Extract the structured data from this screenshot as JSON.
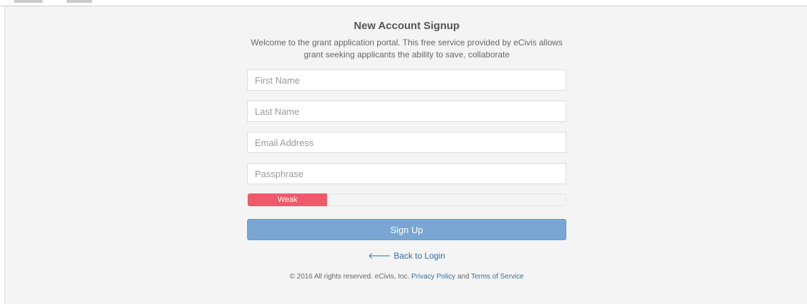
{
  "signup": {
    "title": "New Account Signup",
    "intro": "Welcome to the grant application portal. This free service provided by eCivis allows grant seeking applicants the ability to save, collaborate",
    "fields": {
      "first_name_placeholder": "First Name",
      "last_name_placeholder": "Last Name",
      "email_placeholder": "Email Address",
      "passphrase_placeholder": "Passphrase"
    },
    "strength": {
      "label": "Weak",
      "level_percent": 25,
      "color": "#ef5a6a"
    },
    "signup_button_label": "Sign Up",
    "back_to_login": "Back to Login"
  },
  "footer": {
    "copyright": "© 2016 All rights reserved. eCivis, Inc.",
    "privacy_label": "Privacy Policy",
    "and_text": "and",
    "terms_label": "Terms of Service"
  },
  "colors": {
    "accent": "#79a6d2",
    "link": "#2f6fa8",
    "weak": "#ef5a6a"
  }
}
